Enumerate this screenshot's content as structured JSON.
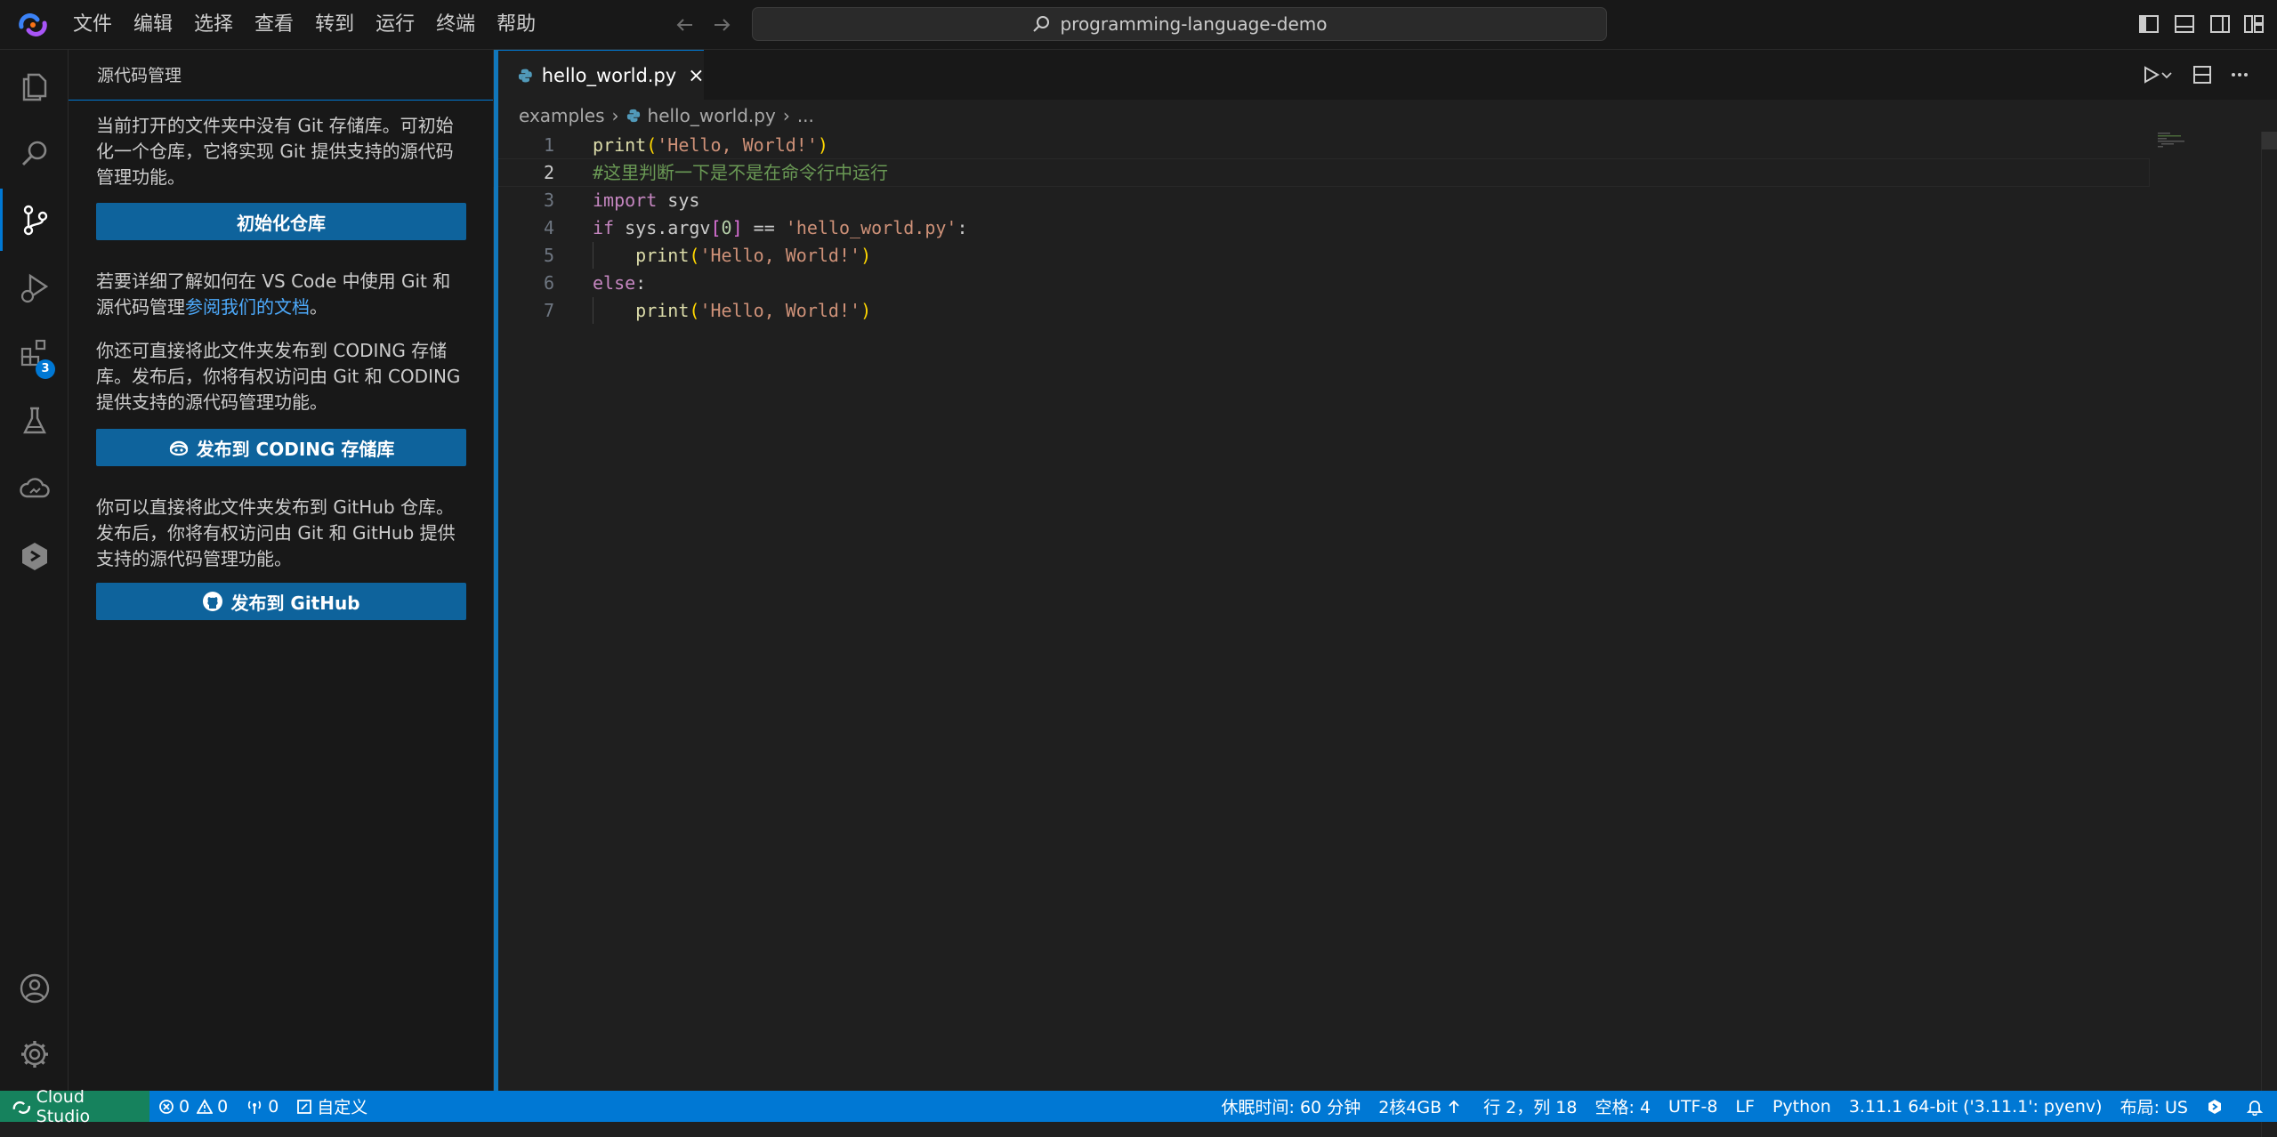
{
  "window": {
    "search_text": "programming-language-demo",
    "menu": [
      "文件",
      "编辑",
      "选择",
      "查看",
      "转到",
      "运行",
      "终端",
      "帮助"
    ]
  },
  "activity_bar": {
    "extensions_badge": "3"
  },
  "sidebar": {
    "title": "源代码管理",
    "para1": "当前打开的文件夹中没有 Git 存储库。可初始化一个仓库，它将实现 Git 提供支持的源代码管理功能。",
    "init_button": "初始化仓库",
    "para2_prefix": "若要详细了解如何在 VS Code 中使用 Git 和源代码管理",
    "para2_link": "参阅我们的文档",
    "para2_suffix": "。",
    "para3": "你还可直接将此文件夹发布到 CODING 存储库。发布后，你将有权访问由 Git 和 CODING 提供支持的源代码管理功能。",
    "coding_button": "发布到 CODING 存储库",
    "para4": "你可以直接将此文件夹发布到 GitHub 仓库。发布后，你将有权访问由 Git 和 GitHub 提供支持的源代码管理功能。",
    "github_button": "发布到 GitHub"
  },
  "editor": {
    "tab_label": "hello_world.py",
    "breadcrumb": [
      "examples",
      "hello_world.py",
      "..."
    ],
    "current_line": 2,
    "lines": [
      {
        "n": "1",
        "tokens": [
          [
            "fn",
            "print"
          ],
          [
            "paren",
            "("
          ],
          [
            "str",
            "'Hello, World!'"
          ],
          [
            "paren",
            ")"
          ]
        ]
      },
      {
        "n": "2",
        "tokens": [
          [
            "cmt",
            "#这里判断一下是不是在命令行中运行"
          ]
        ]
      },
      {
        "n": "3",
        "tokens": [
          [
            "kw",
            "import"
          ],
          [
            "pl",
            " sys"
          ]
        ]
      },
      {
        "n": "4",
        "tokens": [
          [
            "kw",
            "if"
          ],
          [
            "pl",
            " sys.argv"
          ],
          [
            "br",
            "["
          ],
          [
            "num",
            "0"
          ],
          [
            "br",
            "]"
          ],
          [
            "pl",
            " == "
          ],
          [
            "str",
            "'hello_world.py'"
          ],
          [
            "pl",
            ":"
          ]
        ]
      },
      {
        "n": "5",
        "indent": true,
        "tokens": [
          [
            "pl",
            "    "
          ],
          [
            "fn",
            "print"
          ],
          [
            "paren",
            "("
          ],
          [
            "str",
            "'Hello, World!'"
          ],
          [
            "paren",
            ")"
          ]
        ]
      },
      {
        "n": "6",
        "tokens": [
          [
            "kw",
            "else"
          ],
          [
            "pl",
            ":"
          ]
        ]
      },
      {
        "n": "7",
        "indent": true,
        "tokens": [
          [
            "pl",
            "    "
          ],
          [
            "fn",
            "print"
          ],
          [
            "paren",
            "("
          ],
          [
            "str",
            "'Hello, World!'"
          ],
          [
            "paren",
            ")"
          ]
        ]
      }
    ]
  },
  "statusbar": {
    "remote": "Cloud Studio",
    "errors": "0",
    "warnings": "0",
    "ports": "0",
    "customize": "自定义",
    "sleep": "休眠时间: 60 分钟",
    "resources": "2核4GB",
    "position": "行 2，列 18",
    "spaces": "空格: 4",
    "encoding": "UTF-8",
    "eol": "LF",
    "language": "Python",
    "interpreter": "3.11.1 64-bit ('3.11.1': pyenv)",
    "layout": "布局: US"
  },
  "colors": {
    "accent": "#0078d4",
    "remote": "#16825d",
    "button": "#0e639c"
  }
}
